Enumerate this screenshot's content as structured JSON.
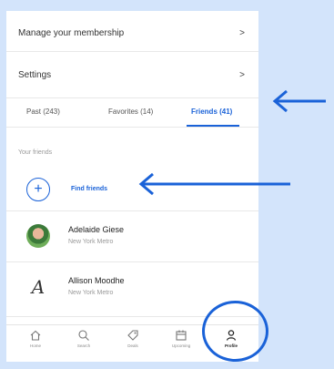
{
  "menu": {
    "membership": {
      "label": "Manage your membership",
      "chevron": ">"
    },
    "settings": {
      "label": "Settings",
      "chevron": ">"
    }
  },
  "tabs": [
    {
      "label": "Past (243)",
      "active": false
    },
    {
      "label": "Favorites (14)",
      "active": false
    },
    {
      "label": "Friends (41)",
      "active": true
    }
  ],
  "friends_section": {
    "heading": "Your friends",
    "find_label": "Find friends",
    "plus": "+",
    "items": [
      {
        "name": "Adelaide Giese",
        "location": "New York Metro",
        "avatar": "photo"
      },
      {
        "name": "Allison Moodhe",
        "location": "New York Metro",
        "avatar": "letter",
        "initial": "A"
      }
    ]
  },
  "nav": [
    {
      "label": "Home",
      "icon": "home-icon",
      "active": false
    },
    {
      "label": "Search",
      "icon": "search-icon",
      "active": false
    },
    {
      "label": "Deals",
      "icon": "tag-icon",
      "active": false
    },
    {
      "label": "Upcoming",
      "icon": "calendar-icon",
      "active": false
    },
    {
      "label": "Profile",
      "icon": "person-icon",
      "active": true
    }
  ],
  "colors": {
    "accent": "#1a62d8",
    "background": "#d3e4fb"
  }
}
